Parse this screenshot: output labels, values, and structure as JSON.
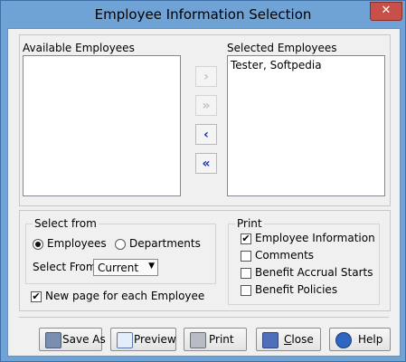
{
  "window": {
    "title": "Employee Information Selection",
    "close_glyph": "✕"
  },
  "available": {
    "label": "Available Employees",
    "items": []
  },
  "selected": {
    "label": "Selected Employees",
    "items": [
      "Tester, Softpedia"
    ]
  },
  "transfer_buttons": {
    "move_one_right": "›",
    "move_all_right": "»",
    "move_one_left": "‹",
    "move_all_left": "«"
  },
  "select_from": {
    "legend": "Select from",
    "options": [
      "Employees",
      "Departments"
    ],
    "selected_option": "Employees",
    "select_from_label": "Select From",
    "dropdown_value": "Current",
    "dropdown_arrow": "▼"
  },
  "new_page": {
    "label": "New page for each Employee",
    "checked": true
  },
  "print_section": {
    "legend": "Print",
    "options": [
      {
        "label": "Employee Information",
        "checked": true
      },
      {
        "label": "Comments",
        "checked": false
      },
      {
        "label": "Benefit Accrual Starts",
        "checked": false
      },
      {
        "label": "Benefit Policies",
        "checked": false
      }
    ]
  },
  "buttons": {
    "save_as": "Save As",
    "preview": "Preview",
    "print": "Print",
    "close_prefix": "C",
    "close_rest": "lose",
    "help": "Help"
  },
  "check_glyph": "✔",
  "colors": {
    "titlebar": "#6fa3d6",
    "close_button": "#c7504a",
    "arrow_enabled": "#1530b0",
    "arrow_disabled": "#c2c2c2"
  },
  "icons": {
    "save_as": "save-as-icon",
    "preview": "preview-icon",
    "print": "printer-icon",
    "close": "door-exit-icon",
    "help": "help-icon"
  }
}
